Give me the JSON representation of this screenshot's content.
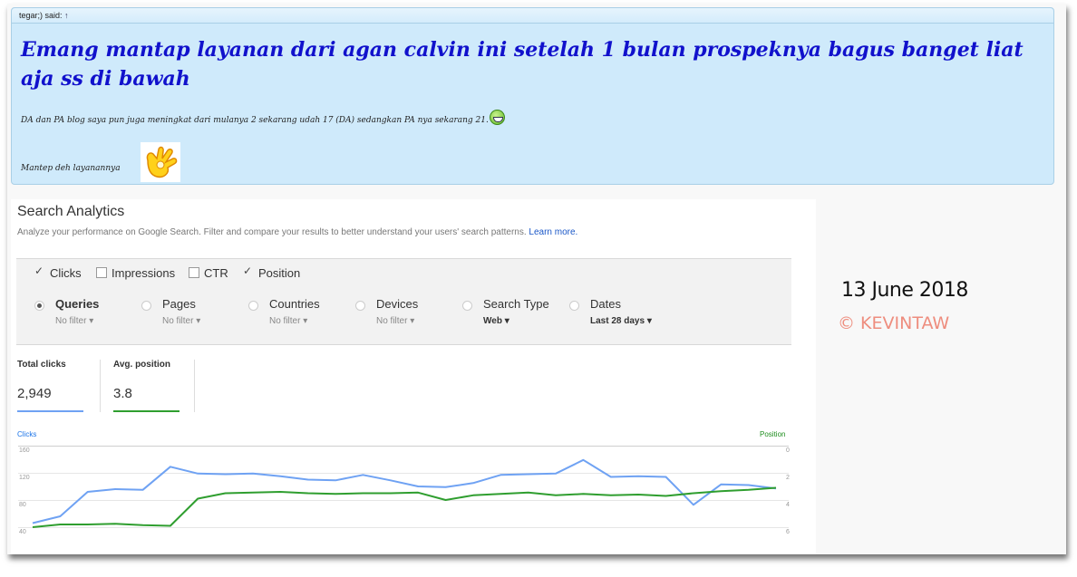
{
  "quote": {
    "author_line": "tegar;) said:",
    "arrow": "↑",
    "title": "Emang mantap layanan dari agan calvin ini setelah 1 bulan prospeknya bagus banget liat aja ss di bawah",
    "line1": "DA dan PA blog saya pun juga meningkat dari mulanya 2 sekarang udah 17 (DA) sedangkan PA nya sekarang 21.",
    "line2": "Mantep deh layanannya"
  },
  "analytics": {
    "title": "Search Analytics",
    "subtitle": "Analyze your performance on Google Search. Filter and compare your results to better understand your users' search patterns.",
    "learn_more": "Learn more.",
    "metrics_toggles": [
      {
        "label": "Clicks",
        "checked": true
      },
      {
        "label": "Impressions",
        "checked": false
      },
      {
        "label": "CTR",
        "checked": false
      },
      {
        "label": "Position",
        "checked": true
      }
    ],
    "dimensions": [
      {
        "label": "Queries",
        "filter": "No filter",
        "selected": true
      },
      {
        "label": "Pages",
        "filter": "No filter",
        "selected": false
      },
      {
        "label": "Countries",
        "filter": "No filter",
        "selected": false
      },
      {
        "label": "Devices",
        "filter": "No filter",
        "selected": false
      },
      {
        "label": "Search Type",
        "filter": "Web",
        "selected": false
      },
      {
        "label": "Dates",
        "filter": "Last 28 days",
        "selected": false
      }
    ],
    "total_clicks_label": "Total clicks",
    "total_clicks_value": "2,949",
    "avg_position_label": "Avg. position",
    "avg_position_value": "3.8",
    "colors": {
      "clicks": "#6fa2f3",
      "position": "#2f9e2f"
    }
  },
  "chart_data": {
    "type": "line",
    "ylabel_left": "Clicks",
    "ylabel_right": "Position",
    "y_left_ticks": [
      "160",
      "120",
      "80",
      "40"
    ],
    "y_right_ticks": [
      "0",
      "2",
      "4",
      "6"
    ],
    "ylim_left": [
      40,
      160
    ],
    "ylim_right": [
      6,
      0
    ],
    "grid": true,
    "series": [
      {
        "name": "Clicks",
        "axis": "left",
        "values": [
          46,
          56,
          92,
          96,
          95,
          129,
          119,
          118,
          119,
          115,
          110,
          109,
          117,
          109,
          100,
          99,
          105,
          117,
          118,
          119,
          139,
          114,
          115,
          114,
          73,
          103,
          102,
          97
        ]
      },
      {
        "name": "Position",
        "axis": "right",
        "values": [
          6.0,
          5.8,
          5.8,
          5.75,
          5.85,
          5.9,
          3.9,
          3.5,
          3.45,
          3.4,
          3.5,
          3.55,
          3.5,
          3.5,
          3.45,
          4.0,
          3.65,
          3.55,
          3.45,
          3.65,
          3.55,
          3.65,
          3.6,
          3.7,
          3.5,
          3.35,
          3.25,
          3.1
        ]
      }
    ]
  },
  "overlay": {
    "date_text": "13 June 2018",
    "credit_text": "© KEVINTAW"
  }
}
